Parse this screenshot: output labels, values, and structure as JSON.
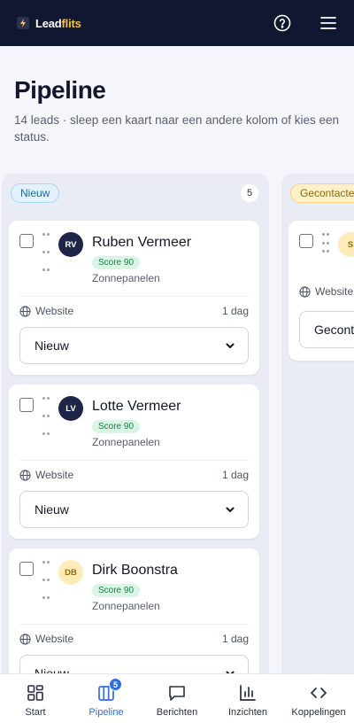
{
  "app": {
    "logo_lead": "Lead",
    "logo_flits": "flits"
  },
  "header": {
    "title": "Pipeline",
    "subtitle": "14 leads · sleep een kaart naar een andere kolom of kies een status."
  },
  "columns": [
    {
      "label": "Nieuw",
      "count": "5",
      "cards": [
        {
          "initials": "RV",
          "name": "Ruben Vermeer",
          "score": "Score 90",
          "sector": "Zonnepanelen",
          "source": "Website",
          "age": "1 dag",
          "status": "Nieuw"
        },
        {
          "initials": "LV",
          "name": "Lotte Vermeer",
          "score": "Score 90",
          "sector": "Zonnepanelen",
          "source": "Website",
          "age": "1 dag",
          "status": "Nieuw"
        },
        {
          "initials": "DB",
          "name": "Dirk Boonstra",
          "score": "Score 90",
          "sector": "Zonnepanelen",
          "source": "Website",
          "age": "1 dag",
          "status": "Nieuw"
        }
      ]
    },
    {
      "label": "Gecontacteerd",
      "cards": [
        {
          "initials": "S",
          "source": "Website",
          "status": "Gecontacteerd"
        }
      ]
    }
  ],
  "nav": [
    {
      "label": "Start",
      "icon": "grid-icon"
    },
    {
      "label": "Pipeline",
      "icon": "kanban-icon",
      "badge": "5"
    },
    {
      "label": "Berichten",
      "icon": "message-icon"
    },
    {
      "label": "Inzichten",
      "icon": "bar-chart-icon"
    },
    {
      "label": "Koppelingen",
      "icon": "code-icon"
    }
  ],
  "colors": {
    "navy": "#121731",
    "accent": "#2f6fdf",
    "logo_yellow": "#f6c343",
    "score_green": "#1d7a47"
  }
}
